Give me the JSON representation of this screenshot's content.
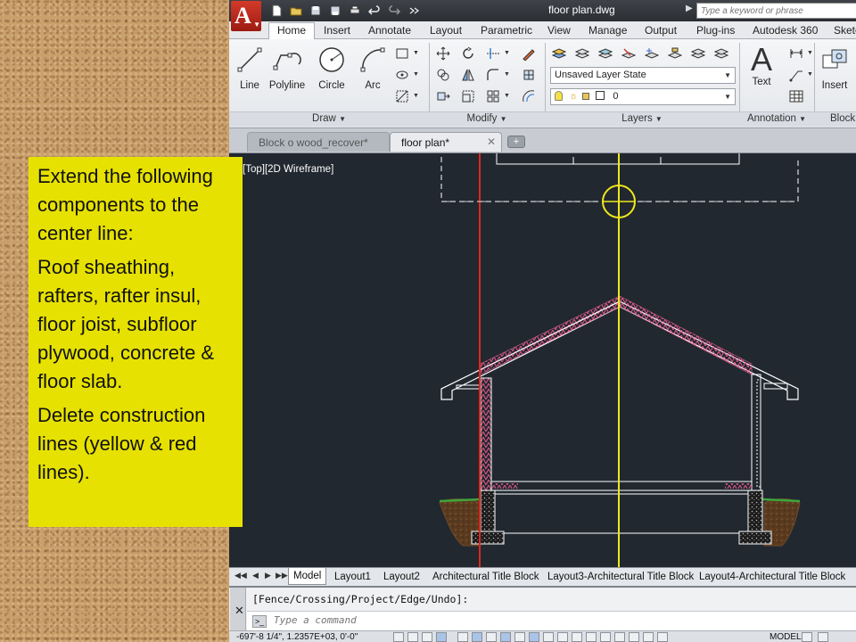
{
  "window": {
    "title": "floor plan.dwg",
    "search_placeholder": "Type a keyword or phrase"
  },
  "ribbon": {
    "tabs": [
      "Home",
      "Insert",
      "Annotate",
      "Layout",
      "Parametric",
      "View",
      "Manage",
      "Output",
      "Plug-ins",
      "Autodesk 360",
      "Sketch"
    ],
    "active_tab": "Home",
    "draw": {
      "line": "Line",
      "polyline": "Polyline",
      "circle": "Circle",
      "arc": "Arc",
      "title": "Draw"
    },
    "modify": {
      "title": "Modify"
    },
    "layers": {
      "layer_state": "Unsaved Layer State",
      "current_layer": "0",
      "title": "Layers"
    },
    "annotation": {
      "text": "Text",
      "title": "Annotation"
    },
    "block": {
      "insert": "Insert",
      "title": "Block"
    }
  },
  "doc_tabs": [
    {
      "label": "Block o wood_recover*",
      "active": false
    },
    {
      "label": "floor plan*",
      "active": true
    }
  ],
  "canvas": {
    "viewport_label": "-][Top][2D Wireframe]",
    "colors": {
      "background": "#212830",
      "center_line": "#f0e81c",
      "construction_line": "#e0261e",
      "insulation": "#e05a8a",
      "geometry": "#ffffff"
    }
  },
  "layout_tabs": [
    "Model",
    "Layout1",
    "Layout2",
    "Architectural Title Block",
    "Layout3-Architectural Title Block",
    "Layout4-Architectural Title Block"
  ],
  "command": {
    "history": "[Fence/Crossing/Project/Edge/Undo]:",
    "placeholder": "Type a command"
  },
  "status": {
    "coords": "-697'-8 1/4\",  1.2357E+03, 0'-0\"",
    "model": "MODEL"
  },
  "note": {
    "p1": "Extend the following components to the center line:",
    "p2": "Roof sheathing, rafters, rafter insul, floor joist, subfloor plywood, concrete & floor slab.",
    "p3": "Delete construction lines (yellow & red lines)."
  }
}
